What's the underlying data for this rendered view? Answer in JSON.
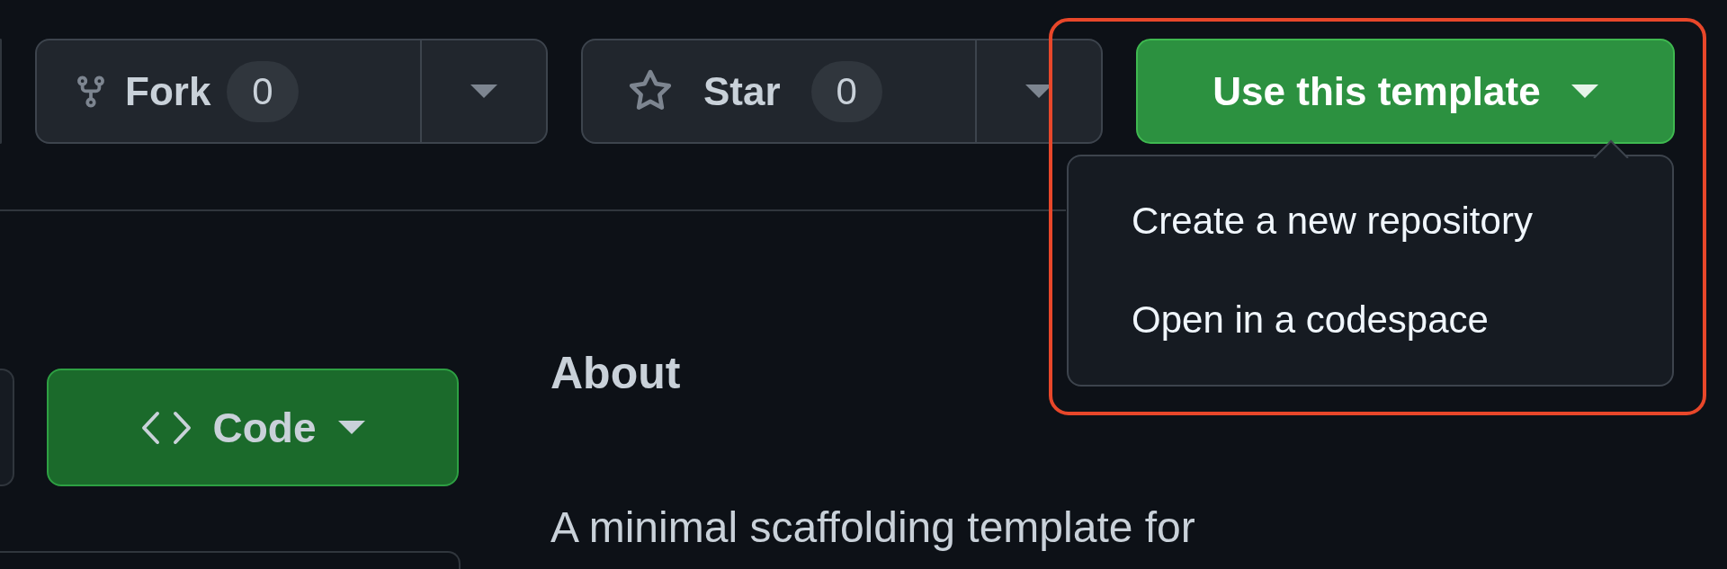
{
  "repo_actions": [
    {
      "kind": "fork",
      "label": "Fork",
      "count": "0"
    },
    {
      "kind": "star",
      "label": "Star",
      "count": "0"
    }
  ],
  "template_button": {
    "label": "Use this template"
  },
  "template_menu": {
    "items": [
      {
        "label": "Create a new repository"
      },
      {
        "label": "Open in a codespace"
      }
    ]
  },
  "code_button": {
    "label": "Code"
  },
  "about": {
    "heading": "About",
    "description": "A minimal scaffolding template for"
  }
}
